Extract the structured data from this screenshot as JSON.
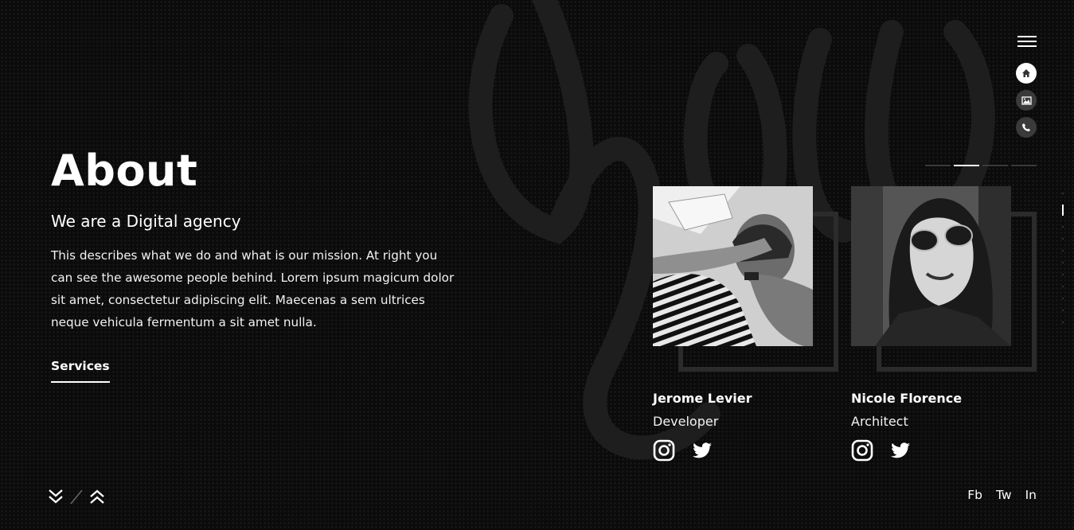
{
  "about": {
    "title": "About",
    "subtitle": "We are a Digital agency",
    "description": "This describes what we do and what is our mission. At right you can see the awesome people behind. Lorem ipsum magicum dolor sit amet, consectetur adipiscing elit. Maecenas a sem ultrices neque vehicula fermentum a sit amet nulla.",
    "link_label": "Services"
  },
  "team": [
    {
      "name": "Jerome Levier",
      "role": "Developer",
      "photo_alt": "person lying down covering face",
      "socials": [
        "instagram-icon",
        "twitter-icon"
      ]
    },
    {
      "name": "Nicole Florence",
      "role": "Architect",
      "photo_alt": "woman with sunglasses",
      "socials": [
        "instagram-icon",
        "twitter-icon"
      ]
    }
  ],
  "side_nav": {
    "icons": [
      "home-icon",
      "gallery-icon",
      "phone-icon"
    ],
    "active": "home-icon"
  },
  "pager": {
    "total": 4,
    "active_index": 1
  },
  "footer": {
    "links": [
      "Fb",
      "Tw",
      "In"
    ]
  },
  "colors": {
    "background": "#0a0a0a",
    "text": "#ffffff",
    "frame": "#2b2b2b"
  }
}
